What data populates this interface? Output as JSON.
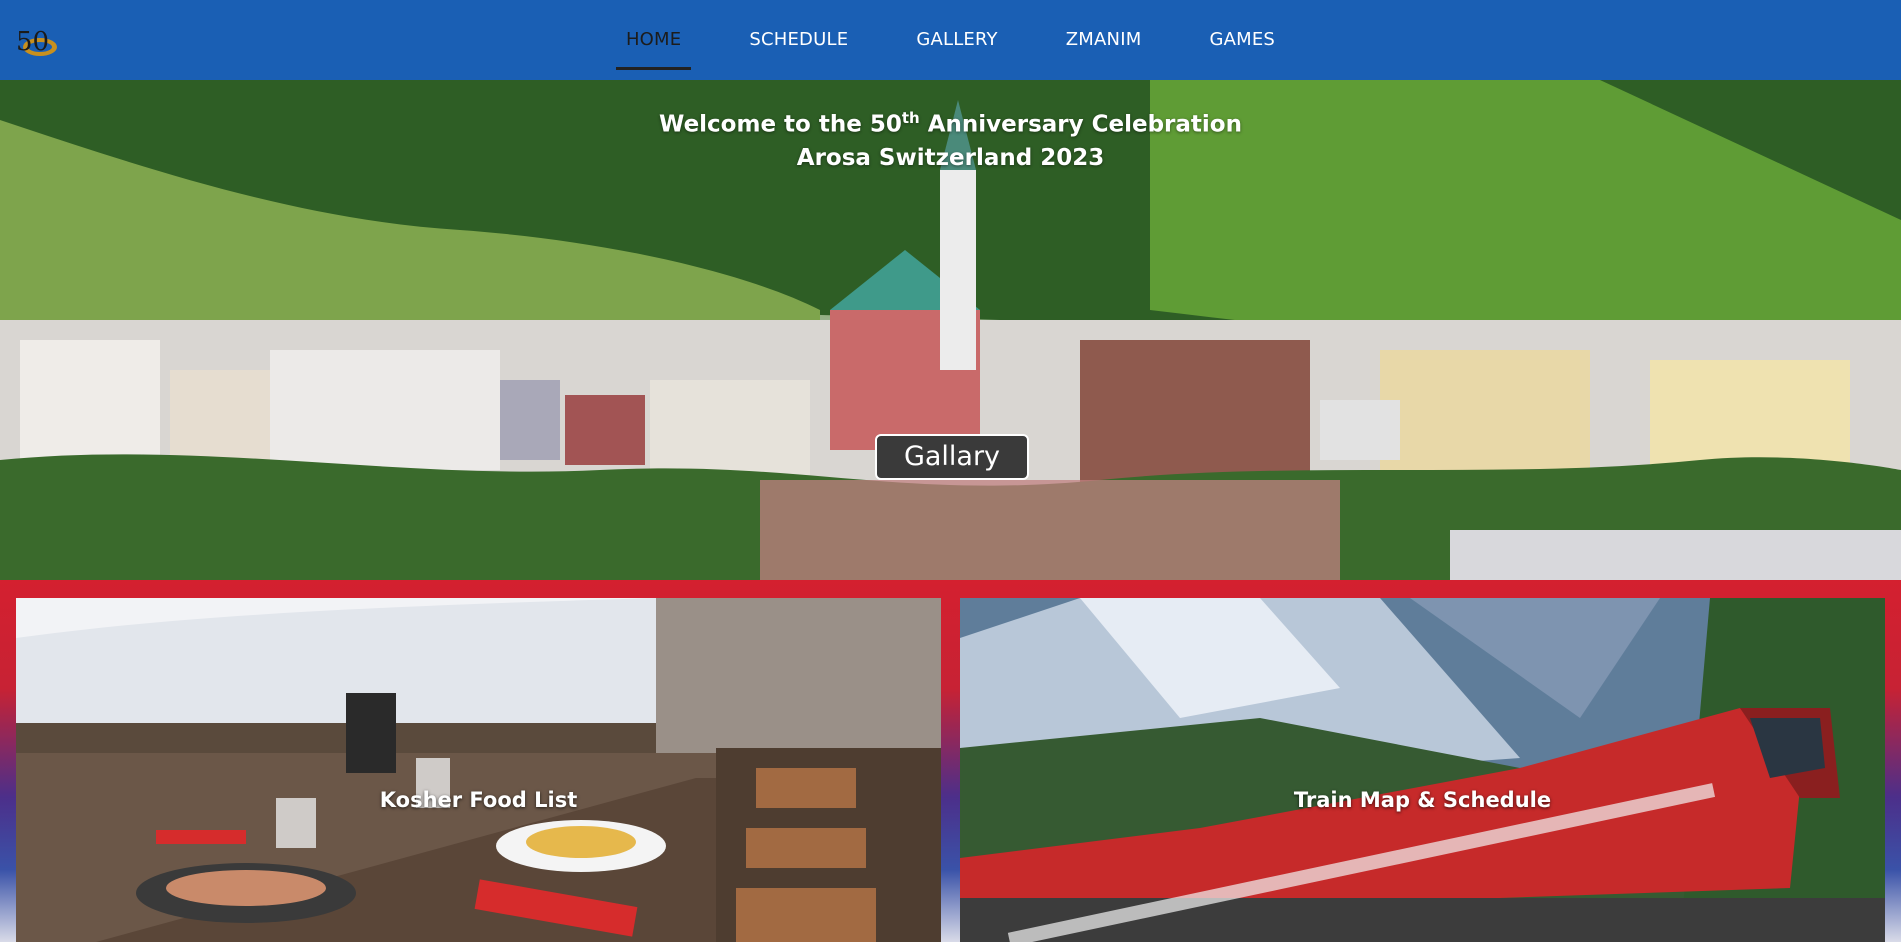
{
  "nav": {
    "logo_text": "50",
    "items": [
      {
        "label": "HOME",
        "active": true
      },
      {
        "label": "SCHEDULE",
        "active": false
      },
      {
        "label": "GALLERY",
        "active": false
      },
      {
        "label": "ZMANIM",
        "active": false
      },
      {
        "label": "GAMES",
        "active": false
      }
    ],
    "background": "#1a5fb4"
  },
  "hero": {
    "title_line1_prefix": "Welcome to the 50",
    "title_line1_sup": "th",
    "title_line1_suffix": " Anniversary Celebration",
    "title_line2": "Arosa Switzerland 2023",
    "button_label": "Gallary"
  },
  "cards": [
    {
      "label": "Kosher Food List",
      "icon": "restaurant-terrace-photo"
    },
    {
      "label": "Train Map & Schedule",
      "icon": "red-train-photo"
    }
  ],
  "colors": {
    "accent_red": "#d4202f",
    "nav_blue": "#1a5fb4"
  }
}
